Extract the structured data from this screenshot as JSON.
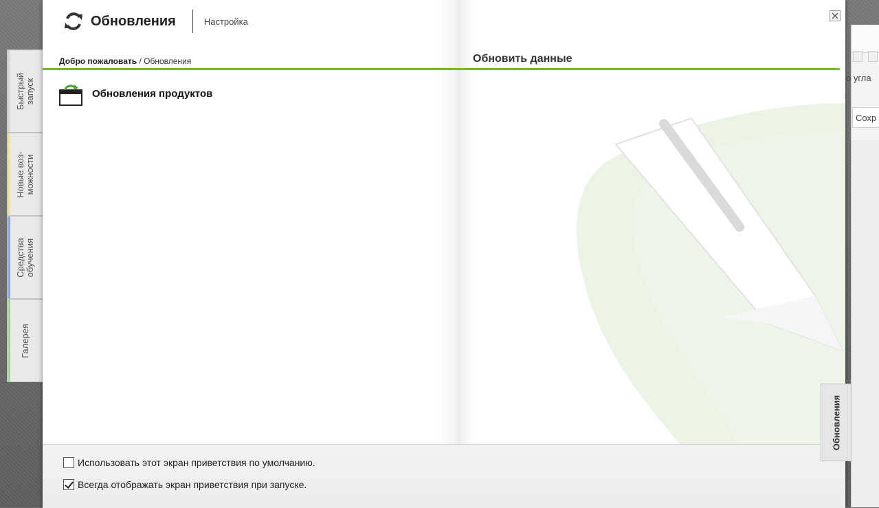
{
  "header": {
    "title": "Обновления",
    "settings_link": "Настройка"
  },
  "breadcrumb": {
    "home": "Добро пожаловать",
    "separator": " / ",
    "current": "Обновления"
  },
  "right_panel": {
    "heading": "Обновить данные"
  },
  "items": [
    {
      "label": "Обновления продуктов",
      "icon": "product-update-icon"
    }
  ],
  "left_tabs": [
    {
      "label_line1": "Быстрый",
      "label_line2": "запуск",
      "accent": "#d8d8d8"
    },
    {
      "label_line1": "Новые воз-",
      "label_line2": "можности",
      "accent": "#e9e3a6"
    },
    {
      "label_line1": "Средства",
      "label_line2": "обучения",
      "accent": "#8fa9d8"
    },
    {
      "label_line1": "Галерея",
      "label_line2": "",
      "accent": "#a9d49a"
    }
  ],
  "right_tab": {
    "label": "Обновления"
  },
  "options": {
    "use_default": {
      "label": "Использовать этот экран приветствия по умолчанию.",
      "checked": false
    },
    "always_show": {
      "label": "Всегда отображать экран приветствия при запуске.",
      "checked": true
    }
  },
  "background_app": {
    "text1": "о угла",
    "text2": "Сохр"
  },
  "colors": {
    "accent_green": "#77b833",
    "watermark_green": "#d9ead0"
  },
  "icons": {
    "close": "close-icon",
    "refresh": "refresh-icon"
  }
}
